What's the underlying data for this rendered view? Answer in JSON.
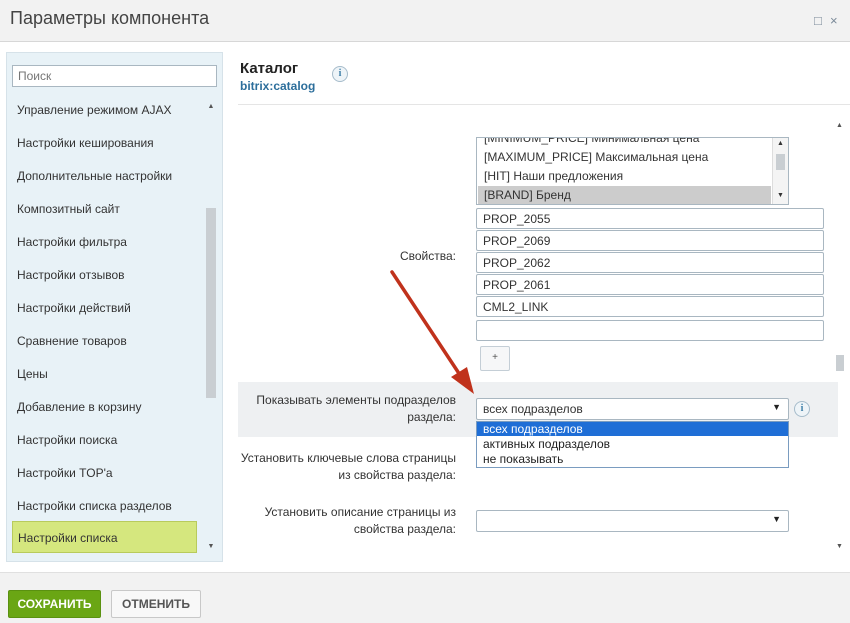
{
  "window": {
    "title": "Параметры компонента",
    "maximize_icon": "□",
    "close_icon": "×"
  },
  "sidebar": {
    "search_placeholder": "Поиск",
    "items": [
      "Управление режимом AJAX",
      "Настройки кеширования",
      "Дополнительные настройки",
      "Композитный сайт",
      "Настройки фильтра",
      "Настройки отзывов",
      "Настройки действий",
      "Сравнение товаров",
      "Цены",
      "Добавление в корзину",
      "Настройки поиска",
      "Настройки TOP'а",
      "Настройки списка разделов",
      "Настройки списка"
    ],
    "active_index": 13
  },
  "component": {
    "name": "Каталог",
    "code": "bitrix:catalog",
    "info_icon": "i"
  },
  "properties": {
    "label": "Свойства:",
    "list_items": [
      "[MINIMUM_PRICE] Минимальная цена",
      "[MAXIMUM_PRICE] Максимальная цена",
      "[HIT] Наши предложения",
      "[BRAND] Бренд"
    ],
    "selected_index": 3,
    "text_values": [
      "PROP_2055",
      "PROP_2069",
      "PROP_2062",
      "PROP_2061",
      "CML2_LINK",
      ""
    ],
    "add_button": "+"
  },
  "show_subsections": {
    "label_line1": "Показывать элементы подразделов",
    "label_line2": "раздела:",
    "value": "всех подразделов",
    "options": [
      "всех подразделов",
      "активных подразделов",
      "не показывать"
    ],
    "selected_index": 0
  },
  "keywords": {
    "label_line1": "Установить ключевые слова страницы",
    "label_line2": "из свойства раздела:"
  },
  "description": {
    "label_line1": "Установить описание страницы из",
    "label_line2": "свойства раздела:",
    "value": ""
  },
  "footer": {
    "save": "СОХРАНИТЬ",
    "cancel": "ОТМЕНИТЬ"
  },
  "colors": {
    "save_button": "#6aa614",
    "active_item": "#d5e77e",
    "dropdown_selected": "#1f6ed6",
    "annotation_arrow": "#c0321c"
  }
}
